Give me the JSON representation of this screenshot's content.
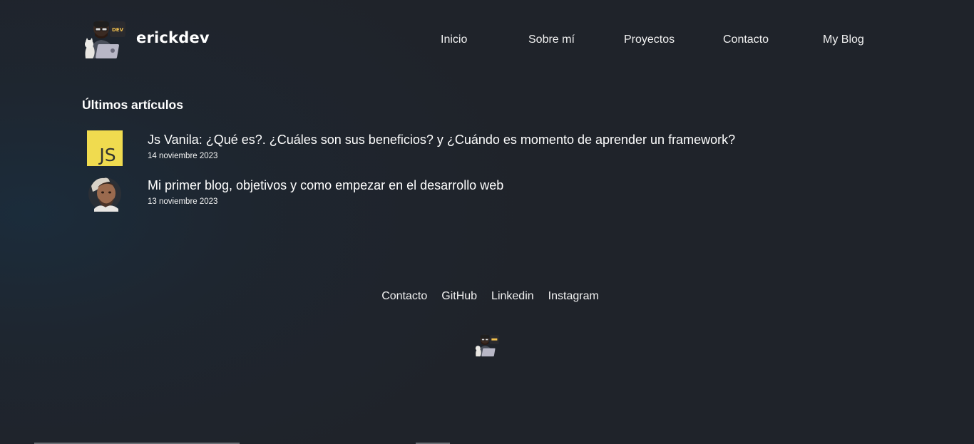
{
  "brand": {
    "name": "erickdev",
    "logo_icon": "developer-avatar-icon",
    "logo_text": "DEV"
  },
  "nav": [
    {
      "label": "Inicio"
    },
    {
      "label": "Sobre mí"
    },
    {
      "label": "Proyectos"
    },
    {
      "label": "Contacto"
    },
    {
      "label": "My Blog"
    }
  ],
  "latest": {
    "title": "Últimos artículos",
    "articles": [
      {
        "title": "Js Vanila: ¿Qué es?. ¿Cuáles son sus beneficios? y ¿Cuándo es momento de aprender un framework?",
        "date": "14 noviembre 2023",
        "thumb_icon": "javascript-logo-icon",
        "thumb_text": "JS",
        "thumb_color": "#f0db4f"
      },
      {
        "title": "Mi primer blog, objetivos y como empezar en el desarrollo web",
        "date": "13 noviembre 2023",
        "thumb_icon": "author-photo-icon"
      }
    ]
  },
  "footer": {
    "links": [
      {
        "label": "Contacto"
      },
      {
        "label": "GitHub"
      },
      {
        "label": "Linkedin"
      },
      {
        "label": "Instagram"
      }
    ],
    "logo_icon": "developer-avatar-icon"
  }
}
